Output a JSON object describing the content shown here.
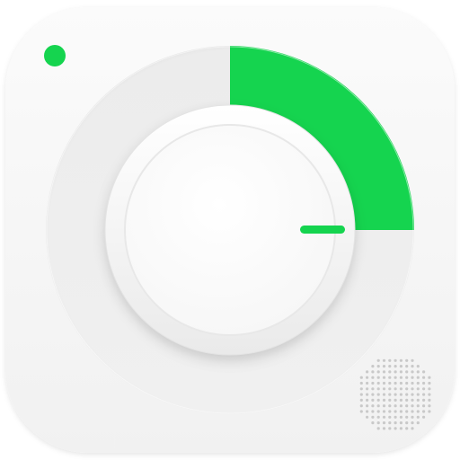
{
  "icon": {
    "accent_color": "#15d44f",
    "timer_progress_fraction": 0.25,
    "status_dot": "green-indicator-dot",
    "speaker": "speaker-grille-icon"
  }
}
